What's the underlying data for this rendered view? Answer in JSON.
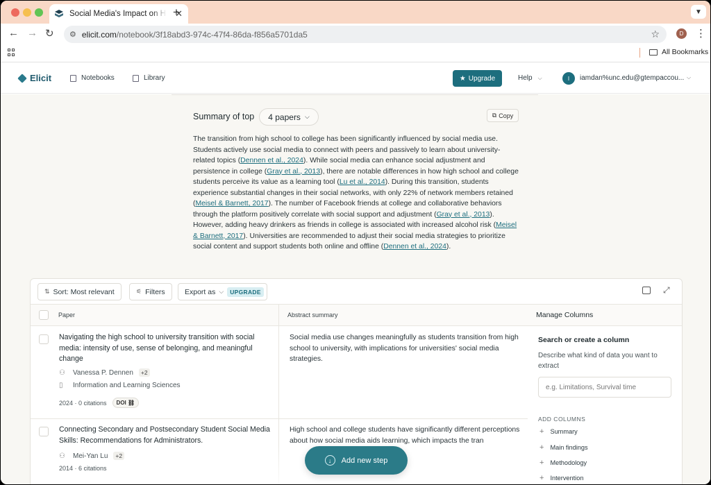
{
  "browser": {
    "tab_title": "Social Media's Impact on High",
    "tab_close": "✕",
    "new_tab": "+",
    "url_host": "elicit.com",
    "url_path": "/notebook/3f18abd3-974c-47f4-86da-f856a5701da5",
    "profile_initial": "D",
    "all_bookmarks": "All Bookmarks"
  },
  "header": {
    "logo": "Elicit",
    "notebooks": "Notebooks",
    "library": "Library",
    "upgrade": "Upgrade",
    "help": "Help",
    "avatar_initial": "I",
    "account": "iamdan%unc.edu@gtempaccou..."
  },
  "summary": {
    "title": "Summary of top",
    "papers_pill": "4 papers",
    "copy": "Copy",
    "p1": "The transition from high school to college has been significantly influenced by social media use. Students actively use social media to connect with peers and passively to learn about university-related topics (",
    "c1": "Dennen et al., 2024",
    "p2": "). While social media can enhance social adjustment and persistence in college (",
    "c2": "Gray et al., 2013",
    "p3": "), there are notable differences in how high school and college students perceive its value as a learning tool (",
    "c3": "Lu et al., 2014",
    "p4": "). During this transition, students experience substantial changes in their social networks, with only 22% of network members retained (",
    "c4": "Meisel & Barnett, 2017",
    "p5": "). The number of Facebook friends at college and collaborative behaviors through the platform positively correlate with social support and adjustment (",
    "c5": "Gray et al., 2013",
    "p6": "). However, adding heavy drinkers as friends in college is associated with increased alcohol risk (",
    "c6": "Meisel & Barnett, 2017",
    "p7": "). Universities are recommended to adjust their social media strategies to prioritize social content and support students both online and offline (",
    "c7": "Dennen et al., 2024",
    "p8": ")."
  },
  "controls": {
    "sort": "Sort: Most relevant",
    "filters": "Filters",
    "export": "Export as",
    "upgrade_badge": "UPGRADE"
  },
  "table": {
    "col_paper": "Paper",
    "col_abstract": "Abstract summary",
    "rows": [
      {
        "title": "Navigating the high school to university transition with social media: intensity of use, sense of belonging, and meaningful change",
        "author": "Vanessa P. Dennen",
        "more_authors": "+2",
        "venue": "Information and Learning Sciences",
        "year_citations": "2024 · 0 citations",
        "doi": "DOI",
        "abstract": "Social media use changes meaningfully as students transition from high school to university, with implications for universities' social media strategies."
      },
      {
        "title": "Connecting Secondary and Postsecondary Student Social Media Skills: Recommendations for Administrators.",
        "author": "Mei-Yan Lu",
        "more_authors": "+2",
        "year_citations": "2014 · 6 citations",
        "abstract": "High school and college students have significantly different perceptions about how social media aids learning, which impacts the tran"
      }
    ]
  },
  "manage_columns": {
    "header": "Manage Columns",
    "title": "Search or create a column",
    "description": "Describe what kind of data you want to extract",
    "placeholder": "e.g. Limitations, Survival time",
    "add_columns_label": "ADD COLUMNS",
    "items": [
      "Summary",
      "Main findings",
      "Methodology",
      "Intervention"
    ]
  },
  "fab": {
    "label": "Add new step"
  },
  "colors": {
    "accent": "#1d6e7e",
    "tab_bar": "#f9d8c6",
    "page_bg": "#f8f7f3"
  }
}
